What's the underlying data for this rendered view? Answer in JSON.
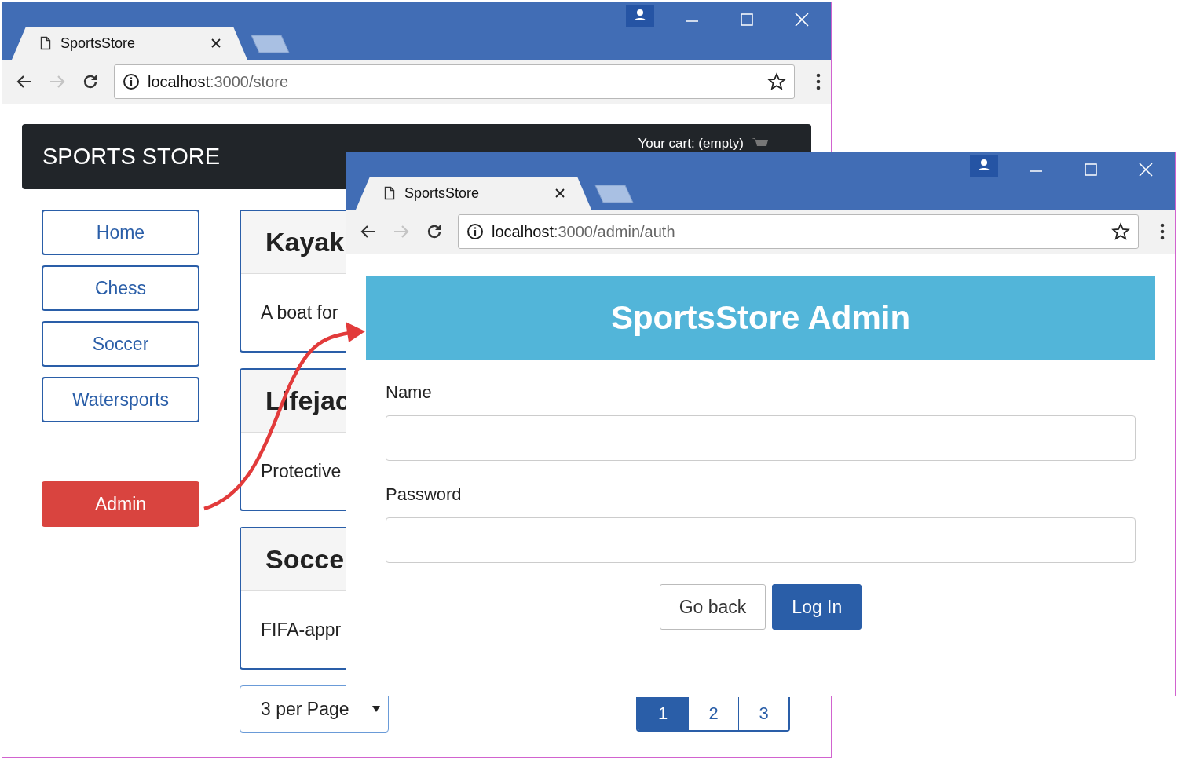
{
  "windows": [
    {
      "kind": "store",
      "tab_title": "SportsStore",
      "url_host": "localhost",
      "url_rest": ":3000/store",
      "forward_disabled": true,
      "brand": "SPORTS STORE",
      "cart": "Your cart: (empty)",
      "categories": [
        {
          "label": "Home",
          "kind": "outline",
          "selected": false
        },
        {
          "label": "Chess",
          "kind": "outline",
          "selected": false
        },
        {
          "label": "Soccer",
          "kind": "outline",
          "selected": false
        },
        {
          "label": "Watersports",
          "kind": "outline",
          "selected": false
        },
        {
          "label": "Admin",
          "kind": "danger",
          "selected": false
        }
      ],
      "products": [
        {
          "name": "Kayak",
          "description": "A boat for"
        },
        {
          "name": "Lifejac",
          "description": "Protective"
        },
        {
          "name": "Socce",
          "description": "FIFA-appr"
        }
      ],
      "page_size": "3 per Page",
      "pages": [
        {
          "label": "1",
          "selected": true
        },
        {
          "label": "2",
          "selected": false
        },
        {
          "label": "3",
          "selected": false
        }
      ]
    },
    {
      "kind": "admin",
      "tab_title": "SportsStore",
      "url_host": "localhost",
      "url_rest": ":3000/admin/auth",
      "forward_disabled": true,
      "heading": "SportsStore Admin",
      "fields": [
        {
          "label": "Name"
        },
        {
          "label": "Password"
        }
      ],
      "buttons": [
        {
          "label": "Go back",
          "kind": "secondary"
        },
        {
          "label": "Log In",
          "kind": "primary"
        }
      ]
    }
  ]
}
